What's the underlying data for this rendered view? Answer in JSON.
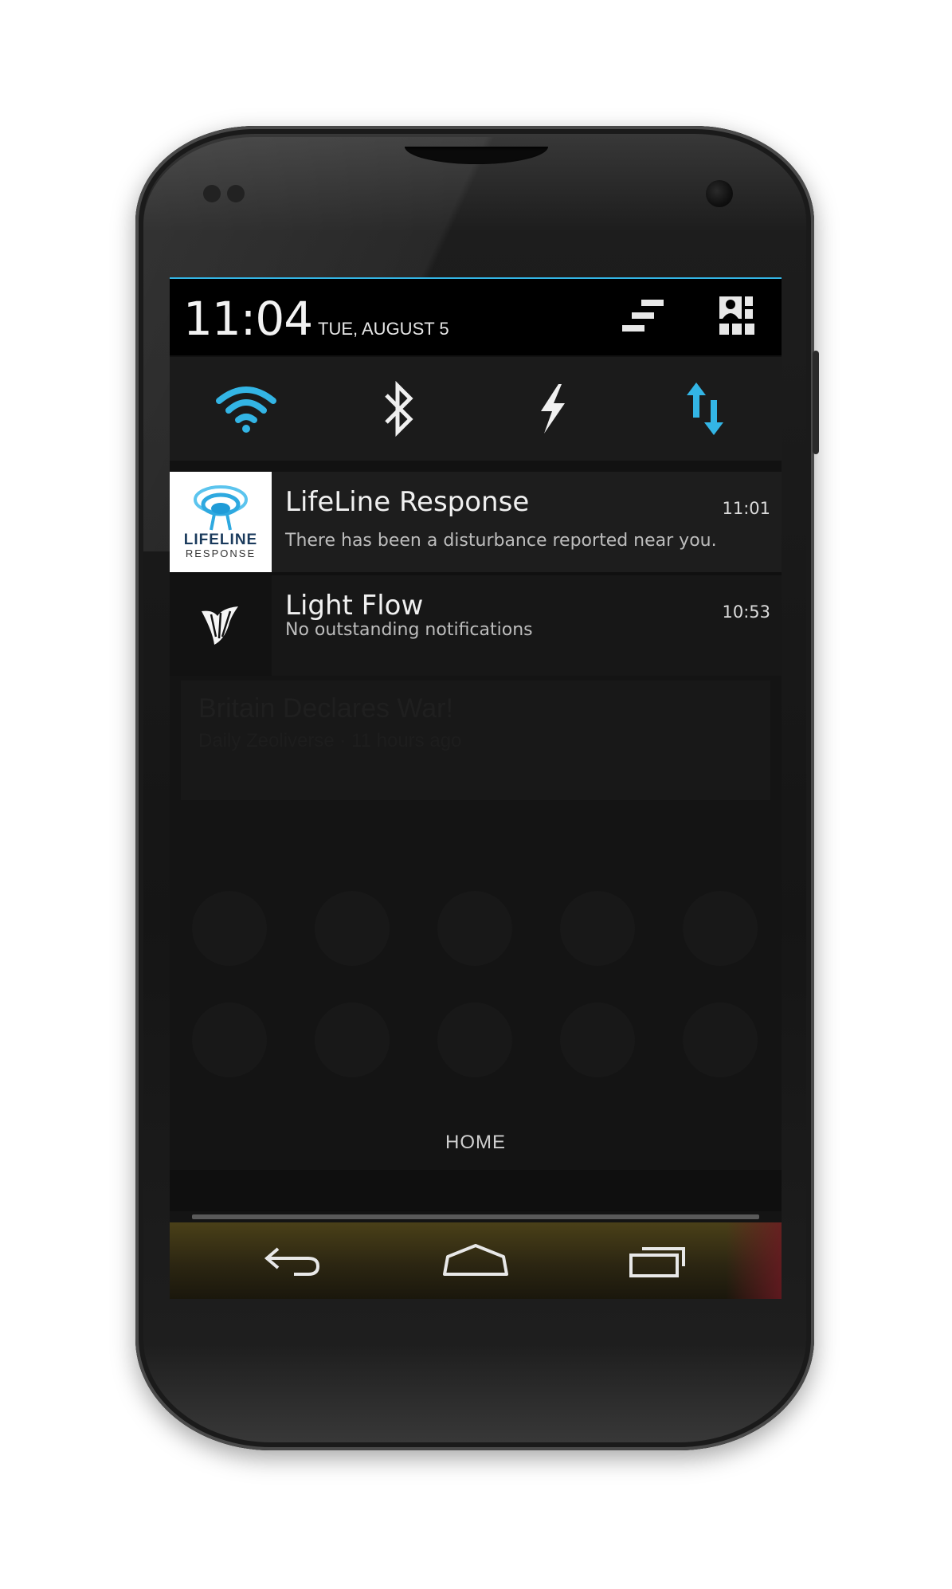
{
  "status": {
    "time": "11:04",
    "date": "TUE, AUGUST 5"
  },
  "header_buttons": {
    "clear_icon": "clear-all-icon",
    "quick_settings_icon": "quick-settings-icon"
  },
  "quick_settings": [
    {
      "name": "wifi",
      "icon": "wifi-icon",
      "active": true
    },
    {
      "name": "bluetooth",
      "icon": "bluetooth-icon",
      "active": false
    },
    {
      "name": "flash",
      "icon": "lightning-icon",
      "active": false
    },
    {
      "name": "data",
      "icon": "data-transfer-icon",
      "active": true
    }
  ],
  "notifications": [
    {
      "app_logo_text": "LIFELINE",
      "app_logo_subtext": "RESPONSE",
      "title": "LifeLine Response",
      "text": "There has been a disturbance reported near you.",
      "time": "11:01"
    },
    {
      "title": "Light Flow",
      "text": "No outstanding notifications",
      "time": "10:53"
    }
  ],
  "background": {
    "card_title": "Britain Declares War!",
    "card_subtitle": "Daily Zeoliverse · 11 hours ago"
  },
  "drawer": {
    "handle_label": "HOME"
  },
  "colors": {
    "accent": "#33b5e5",
    "header_bg": "#000000",
    "notification_bg": "#1d1d1d"
  }
}
